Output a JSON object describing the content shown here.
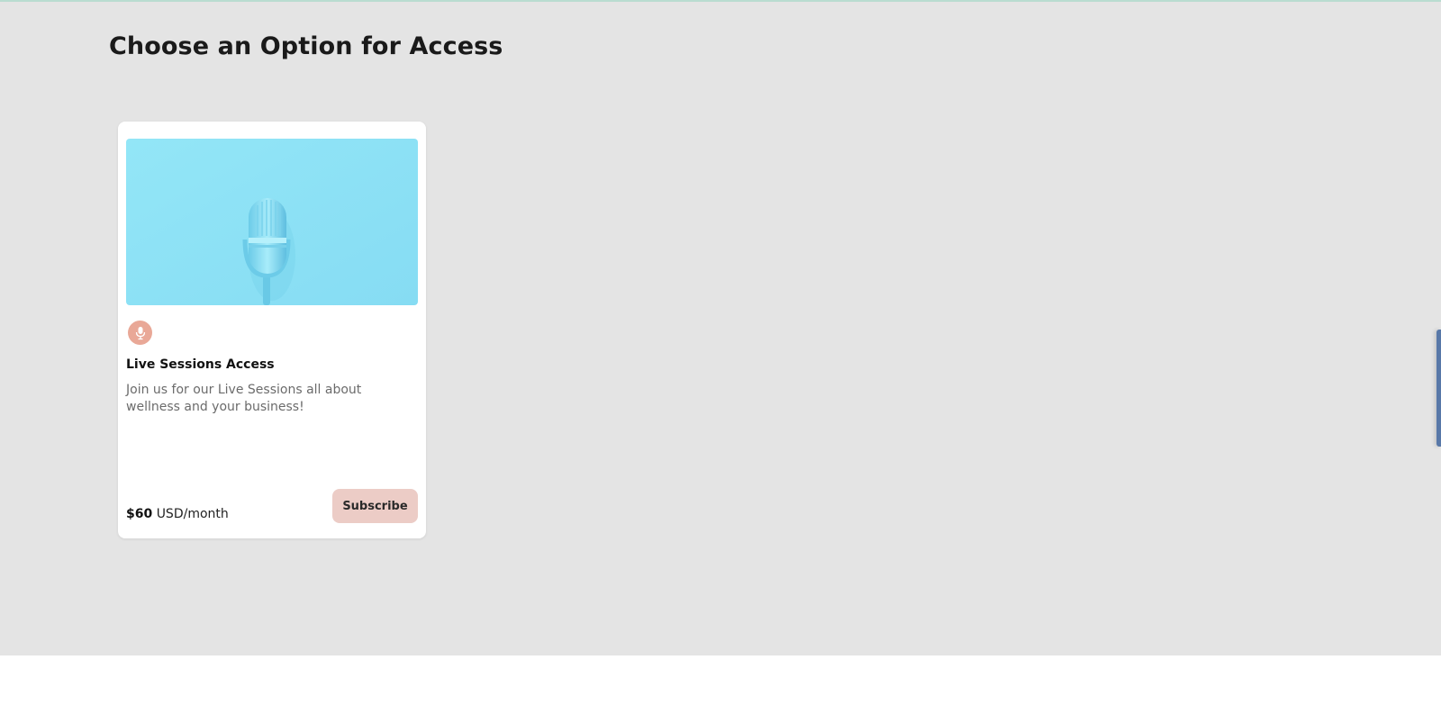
{
  "page": {
    "title": "Choose an Option for Access"
  },
  "options": [
    {
      "image_icon": "microphone-image",
      "badge_icon": "microphone-icon",
      "title": "Live Sessions Access",
      "description": "Join us for our Live Sessions all about wellness and your business!",
      "price_amount": "$60",
      "price_unit": "USD/month",
      "button_label": "Subscribe"
    }
  ],
  "colors": {
    "section_bg": "#e4e4e4",
    "badge": "#e9a897",
    "button": "#ecccc6",
    "image_bg": "#8fe3f5"
  }
}
